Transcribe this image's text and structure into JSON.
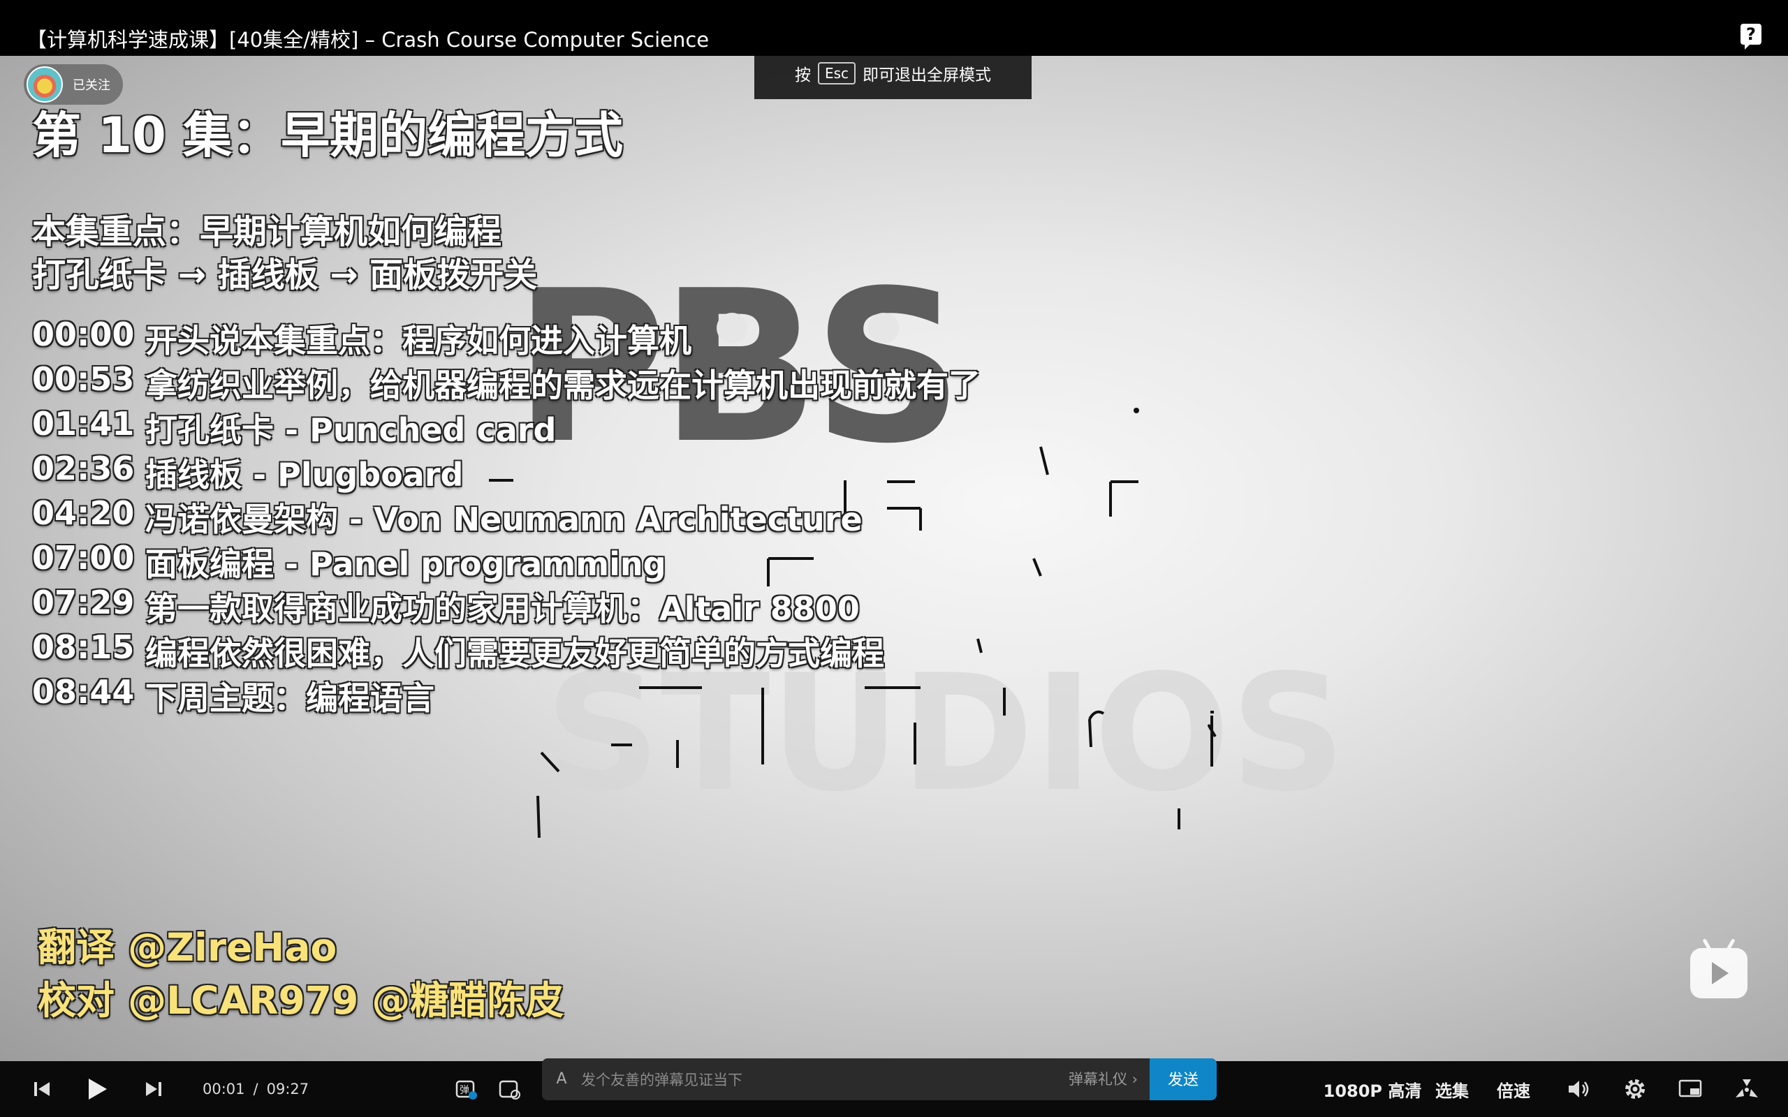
{
  "window": {
    "title": "【计算机科学速成课】[40集全/精校] – Crash Course Computer Science",
    "help_icon": "help-icon"
  },
  "video": {
    "follow_label": "已关注",
    "esc_hint": {
      "prefix": "按",
      "key": "Esc",
      "suffix": "即可退出全屏模式"
    },
    "episode_title": "第 10 集：早期的编程方式",
    "focus_lines": [
      "本集重点：早期计算机如何编程",
      "打孔纸卡 → 插线板 → 面板拨开关"
    ],
    "chapters": [
      {
        "time": "00:00",
        "text": "开头说本集重点：程序如何进入计算机"
      },
      {
        "time": "00:53",
        "text": "拿纺织业举例，给机器编程的需求远在计算机出现前就有了"
      },
      {
        "time": "01:41",
        "text": "打孔纸卡 - Punched card"
      },
      {
        "time": "02:36",
        "text": "插线板 - Plugboard"
      },
      {
        "time": "04:20",
        "text": "冯诺依曼架构 - Von Neumann Architecture"
      },
      {
        "time": "07:00",
        "text": "面板编程 - Panel programming"
      },
      {
        "time": "07:29",
        "text": "第一款取得商业成功的家用计算机：Altair 8800"
      },
      {
        "time": "08:15",
        "text": "编程依然很困难，人们需要更友好更简单的方式编程"
      },
      {
        "time": "08:44",
        "text": "下周主题：编程语言"
      }
    ],
    "credits": [
      "翻译 @ZireHao",
      "校对 @LCAR979 @糖醋陈皮"
    ],
    "background_logo": "PBS",
    "accent_color": "#f8e27a"
  },
  "controls": {
    "current_time": "00:01",
    "separator": "/",
    "duration": "09:27",
    "danmaku_placeholder": "发个友善的弹幕见证当下",
    "etiquette_label": "弹幕礼仪 ›",
    "send_label": "发送",
    "quality_label": "1080P 高清",
    "episodes_label": "选集",
    "speed_label": "倍速",
    "send_color": "#0f86c8"
  }
}
